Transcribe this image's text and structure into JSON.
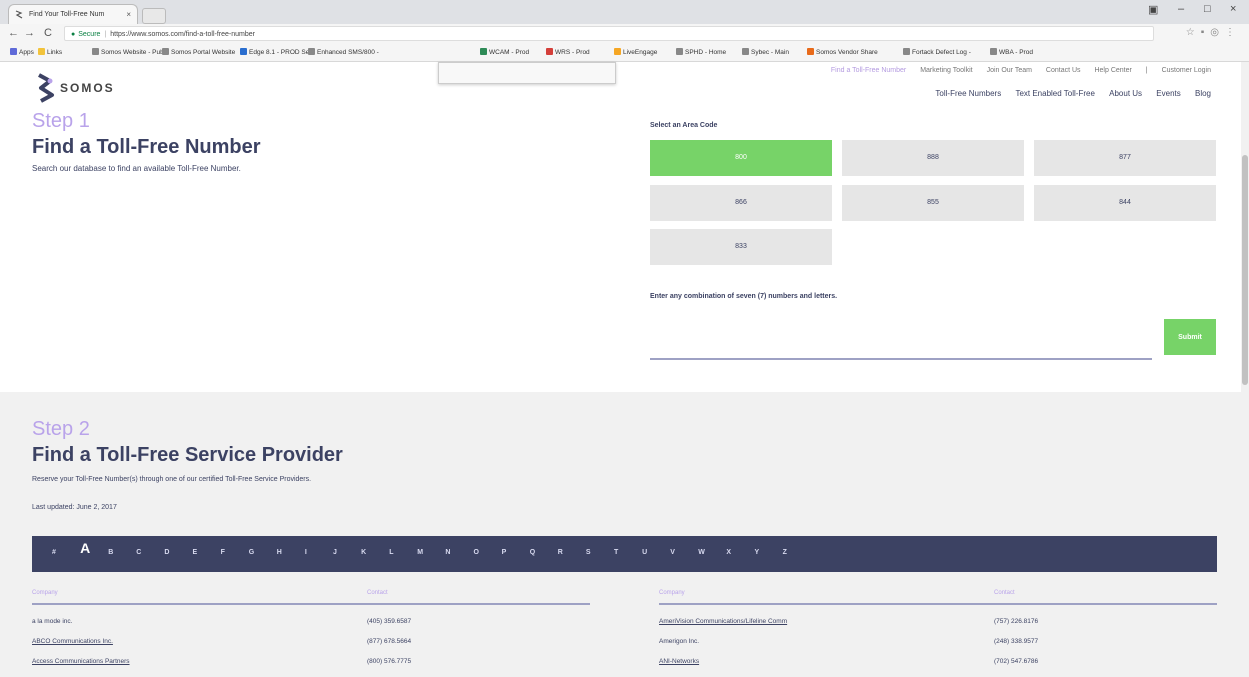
{
  "browser": {
    "tab_title": "Find Your Toll-Free Num",
    "tab_close": "×",
    "url_secure": "Secure",
    "url": "https://www.somos.com/find-a-toll-free-number",
    "window_controls": [
      "–",
      "□",
      "×"
    ],
    "nav_icons": [
      "←",
      "→",
      "C"
    ],
    "bookmarks": [
      {
        "label": "Apps",
        "color": "#5f6ad8"
      },
      {
        "label": "Links",
        "color": "#f2c33b"
      },
      {
        "label": "Somos Website - Pub",
        "color": "#888888"
      },
      {
        "label": "Somos Portal Website",
        "color": "#888888"
      },
      {
        "label": "Edge 8.1 - PROD Serv",
        "color": "#2a6ecf"
      },
      {
        "label": "Enhanced SMS/800 -",
        "color": "#888888"
      },
      {
        "label": "WCAM - Prod",
        "color": "#2e8b57"
      },
      {
        "label": "WRS - Prod",
        "color": "#d43f3a"
      },
      {
        "label": "LiveEngage",
        "color": "#f5a623"
      },
      {
        "label": "SPHD - Home",
        "color": "#888888"
      },
      {
        "label": "Sybec - Main",
        "color": "#888888"
      },
      {
        "label": "Somos Vendor Share",
        "color": "#e86a1a"
      },
      {
        "label": "Fortack Defect Log -",
        "color": "#888888"
      },
      {
        "label": "WBA - Prod",
        "color": "#888888"
      }
    ]
  },
  "header": {
    "logo_text": "SOMOS",
    "utility_nav": [
      "Find a Toll-Free Number",
      "Marketing Toolkit",
      "Join Our Team",
      "Contact Us",
      "Help Center",
      "|",
      "Customer Login"
    ],
    "main_nav": [
      "Toll-Free Numbers",
      "Text Enabled Toll-Free",
      "About Us",
      "Events",
      "Blog"
    ]
  },
  "step1": {
    "label": "Step 1",
    "title": "Find a Toll-Free Number",
    "description": "Search our database to find an available Toll-Free Number.",
    "area_label": "Select an Area Code",
    "area_codes": [
      "800",
      "888",
      "877",
      "866",
      "855",
      "844",
      "833"
    ],
    "selected_area_code": "800",
    "combo_label": "Enter any combination of seven (7) numbers and letters.",
    "combo_value": "",
    "submit_label": "Submit"
  },
  "step2": {
    "label": "Step 2",
    "title": "Find a Toll-Free Service Provider",
    "description": "Reserve your Toll-Free Number(s) through one of our certified Toll-Free Service Providers.",
    "updated": "Last updated: June 2, 2017",
    "alphabet": [
      "#",
      "A",
      "B",
      "C",
      "D",
      "E",
      "F",
      "G",
      "H",
      "I",
      "J",
      "K",
      "L",
      "M",
      "N",
      "O",
      "P",
      "Q",
      "R",
      "S",
      "T",
      "U",
      "V",
      "W",
      "X",
      "Y",
      "Z"
    ],
    "active_letter": "A",
    "columns": {
      "company": "Company",
      "contact": "Contact"
    },
    "left_rows": [
      {
        "company": "a la mode inc.",
        "contact": "(405) 359.6587",
        "link": false
      },
      {
        "company": "ABCO Communications Inc.",
        "contact": "(877) 678.5664",
        "link": true
      },
      {
        "company": "Access Communications Partners",
        "contact": "(800) 576.7775",
        "link": true
      }
    ],
    "right_rows": [
      {
        "company": "AmeriVision Communications/Lifeline Comm",
        "contact": "(757) 226.8176",
        "link": true
      },
      {
        "company": "Amerigon Inc.",
        "contact": "(248) 338.9577",
        "link": false
      },
      {
        "company": "ANI-Networks",
        "contact": "(702) 547.6786",
        "link": true
      }
    ]
  }
}
